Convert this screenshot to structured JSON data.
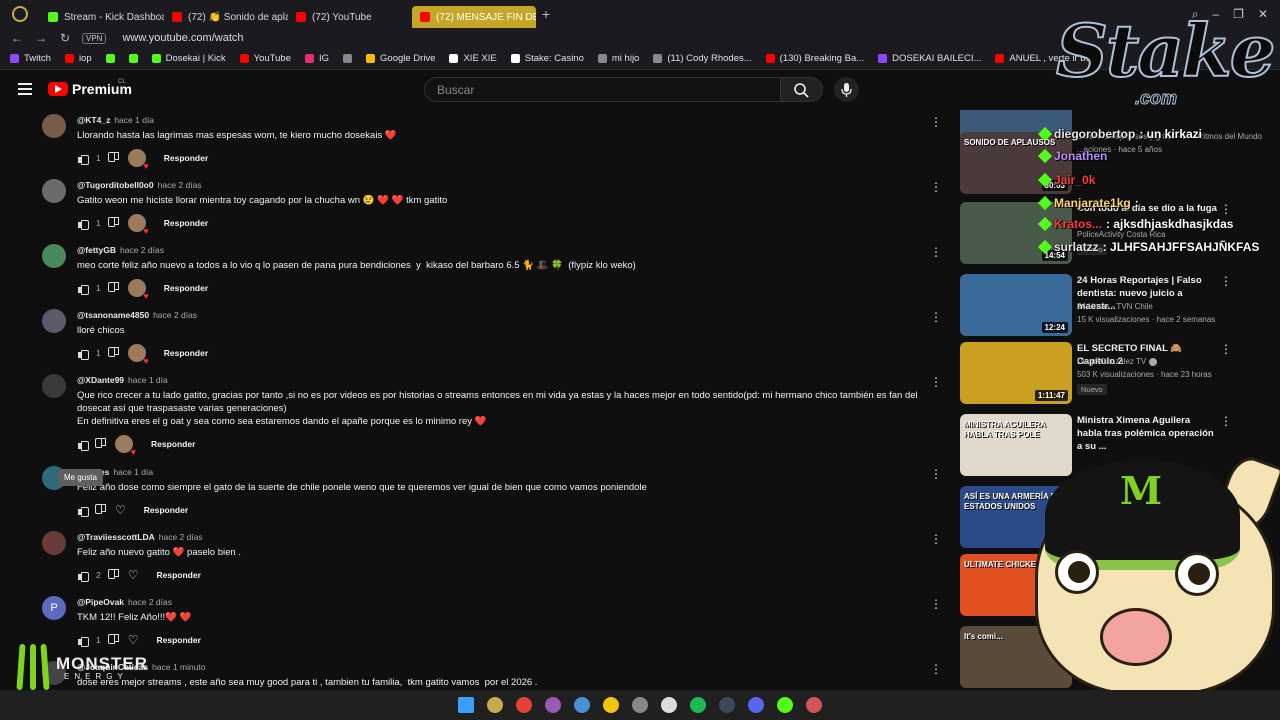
{
  "browser": {
    "tabs": [
      {
        "label": "",
        "color": "#c9a94e",
        "active": false
      },
      {
        "label": "Stream - Kick Dashboard",
        "color": "#53fc18",
        "active": false
      },
      {
        "label": "(72) 👏 Sonido de aplausos",
        "color": "#ff0000",
        "active": false
      },
      {
        "label": "(72) YouTube",
        "color": "#ff0000",
        "active": false
      },
      {
        "label": "(72) MENSAJE FIN DE AÑO",
        "color": "#ff0000",
        "active": true
      }
    ],
    "address": {
      "vpn": "VPN",
      "url": "www.youtube.com/watch"
    },
    "bookmarks": [
      {
        "label": "Twitch",
        "color": "#9146ff"
      },
      {
        "label": "iop",
        "color": "#ff0000"
      },
      {
        "label": "",
        "color": "#53fc18"
      },
      {
        "label": "",
        "color": "#53fc18"
      },
      {
        "label": "Dosekai | Kick",
        "color": "#53fc18"
      },
      {
        "label": "YouTube",
        "color": "#ff0000"
      },
      {
        "label": "IG",
        "color": "#e1306c"
      },
      {
        "label": "",
        "color": "#888888"
      },
      {
        "label": "Google Drive",
        "color": "#fbbc04"
      },
      {
        "label": "XIE XIE",
        "color": "#ffffff"
      },
      {
        "label": "Stake: Casino",
        "color": "#ffffff"
      },
      {
        "label": "mi hijo",
        "color": "#888888"
      },
      {
        "label": "(11) Cody Rhodes...",
        "color": "#888888"
      },
      {
        "label": "(130) Breaking Ba...",
        "color": "#ff0000"
      },
      {
        "label": "DOSEKAI BAILECI...",
        "color": "#9146ff"
      },
      {
        "label": "ANUEL , verte ir b...",
        "color": "#ff0000"
      }
    ]
  },
  "youtube": {
    "brand": "Premium",
    "region": "CL",
    "search_placeholder": "Buscar"
  },
  "comments": [
    {
      "author": "@KT4_z",
      "time": "hace 1 día",
      "text": "Llorando hasta las lagrimas mas espesas wom, te kiero mucho dosekais ❤️",
      "likes": "1",
      "reply": "Responder",
      "avatar": "#7a5a48",
      "hearted": true
    },
    {
      "author": "@Tugorditobell0o0",
      "time": "hace 2 días",
      "text": "Gatito weon me hiciste llorar mientra toy cagando por la chucha wn 😢 ❤️ ❤️ tkm gatito",
      "likes": "1",
      "reply": "Responder",
      "avatar": "#6b6b6b",
      "hearted": true
    },
    {
      "author": "@fettyGB",
      "time": "hace 2 días",
      "text": "meo corte feliz año nuevo a todos a lo vio q lo pasen de pana pura bendiciones  y  kikaso del barbaro 6.5 🐈 🎩 🍀  (flypiz klo weko)",
      "likes": "1",
      "reply": "Responder",
      "avatar": "#4a8a5a",
      "hearted": true
    },
    {
      "author": "@tsanoname4850",
      "time": "hace 2 días",
      "text": "lloré chicos",
      "likes": "1",
      "reply": "Responder",
      "avatar": "#5a5a6a",
      "hearted": true
    },
    {
      "author": "@XDante99",
      "time": "hace 1 día",
      "text": "Que rico crecer a tu lado gatito, gracias por tanto ,si no es por videos es por historias o streams entonces en mi vida ya estas y la haces mejor en todo sentido(pd: mi hermano chico también es fan del dosecat así que traspasaste varias generaciones)\nEn definitiva eres el g oat y sea como sea estaremos dando el apañe porque es lo minimo rey ❤️",
      "likes": "",
      "reply": "Responder",
      "avatar": "#3a3a3a",
      "hearted": true
    },
    {
      "author": "@...mes",
      "time": "hace 1 día",
      "text": "Feliz año dose como siempre el gato de la suerte de chile ponele weno que te queremos ver igual de bien que como vamos poniendole",
      "likes": "",
      "reply": "Responder",
      "avatar": "#2d6a7a",
      "hearted": false
    },
    {
      "author": "@TraviiesscottLDA",
      "time": "hace 2 días",
      "text": "Feliz año nuevo gatito ❤️ paselo bien .",
      "likes": "2",
      "reply": "Responder",
      "avatar": "#6a3a3a",
      "hearted": false
    },
    {
      "author": "@PipeOvak",
      "time": "hace 2 días",
      "text": "TKM 12!! Feliz Año!!!❤️ ❤️",
      "likes": "1",
      "reply": "Responder",
      "avatar": "#5c6bc0",
      "initial": "P",
      "hearted": false
    },
    {
      "author": "@JoaquinCaticas",
      "time": "hace 1 minuto",
      "text": "dose eres mejor streams , este año sea muy good para ti , tambien tu familia,  tkm gatito vamos  por el 2026 .",
      "likes": "",
      "reply": "Responder",
      "avatar": "#444444",
      "hearted": false
    }
  ],
  "tooltip": "Me gusta",
  "related": [
    {
      "title": "",
      "channel": "",
      "views": "",
      "duration": "22:22",
      "thumb": "#3b5a7a",
      "new": ""
    },
    {
      "title": "",
      "channel": "Sonido de aplausos y gritos · Los Ritmos del Mundo",
      "views": "...aciones · hace 5 años",
      "duration": "30:03",
      "thumb": "#4a3a3a",
      "label": "SONIDO DE APLAUSOS",
      "new": ""
    },
    {
      "title": "Con todo al día se dio a la fuga",
      "channel": "PoliceActivity Costa Rica",
      "views": "",
      "duration": "14:54",
      "thumb": "#4a5a4a",
      "new": "Nuevo"
    },
    {
      "title": "24 Horas Reportajes | Falso dentista: nuevo juicio a maestr...",
      "channel": "24 Horas - TVN Chile",
      "views": "15 K visualizaciones · hace 2 semanas",
      "duration": "12:24",
      "thumb": "#3a6a9a",
      "new": ""
    },
    {
      "title": "EL SECRETO FINAL 🙈 Capítulo 2",
      "channel": "Diego González TV",
      "views": "503 K visualizaciones · hace 23 horas",
      "duration": "1:11:47",
      "thumb": "#c9a020",
      "new": "Nuevo"
    },
    {
      "title": "Ministra Ximena Aguilera habla tras polémica operación a su ...",
      "channel": "",
      "views": "",
      "duration": "",
      "thumb": "#e0d8c8",
      "label": "MINISTRA AGUILERA HABLA TRAS POLÉ",
      "new": ""
    },
    {
      "title": "",
      "channel": "",
      "views": "",
      "duration": "",
      "thumb": "#2a4a8a",
      "label": "ASÍ ES UNA ARMERÍA EN ESTADOS UNIDOS",
      "new": ""
    },
    {
      "title": "",
      "channel": "",
      "views": "",
      "duration": "",
      "thumb": "#e05020",
      "label": "ULTIMATE CHICKEN",
      "new": ""
    },
    {
      "title": "",
      "channel": "",
      "views": "",
      "duration": "",
      "thumb": "#5a4a3a",
      "label": "It's comi...",
      "new": ""
    }
  ],
  "overlay": {
    "logo": "Stake",
    "logo_sub": ".com",
    "chat": [
      {
        "user": "diegorobertop",
        "msg": ": un kirkazi",
        "color": "#e6e6e6"
      },
      {
        "user": "Jonathen",
        "msg": "",
        "color": "#b98cff"
      },
      {
        "user": "Jair_0k",
        "msg": "",
        "color": "#ff3b3b"
      },
      {
        "user": "Manjarate1kg",
        "msg": ":",
        "color": "#ffd36b"
      },
      {
        "user": "Kratos...",
        "msg": ": ajksdhjaskdhasjkdas",
        "color": "#ff3b3b"
      },
      {
        "user": "surlatzz",
        "msg": ": JLHFSAHJFFSAHJÑKFAS",
        "color": "#e6e6e6"
      }
    ],
    "sponsor": "MONSTER",
    "sponsor_sub": "ENERGY"
  },
  "taskbar": [
    {
      "name": "windows-start-icon",
      "color": "#3aa0ff"
    },
    {
      "name": "opera-gx-icon",
      "color": "#c9a94e"
    },
    {
      "name": "chrome-icon",
      "color": "#e34133"
    },
    {
      "name": "vs-icon",
      "color": "#9b59b6"
    },
    {
      "name": "app-icon",
      "color": "#4a90d9"
    },
    {
      "name": "files-icon",
      "color": "#f1c40f"
    },
    {
      "name": "obs-icon",
      "color": "#888888"
    },
    {
      "name": "capcut-icon",
      "color": "#dddddd"
    },
    {
      "name": "spotify-icon",
      "color": "#1db954"
    },
    {
      "name": "steam-icon",
      "color": "#3a4a5a"
    },
    {
      "name": "discord-icon",
      "color": "#5865f2"
    },
    {
      "name": "xbox-icon",
      "color": "#53fc18"
    },
    {
      "name": "app2-icon",
      "color": "#d35454"
    }
  ]
}
